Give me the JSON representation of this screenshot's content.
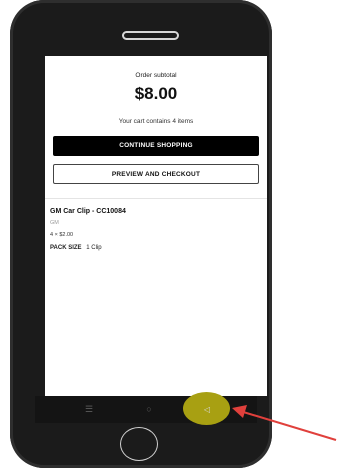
{
  "cart": {
    "subtotal_label": "Order subtotal",
    "subtotal_amount": "$8.00",
    "item_count_text": "Your cart contains 4 items",
    "continue_label": "CONTINUE SHOPPING",
    "checkout_label": "PREVIEW AND CHECKOUT"
  },
  "item": {
    "title": "GM Car Clip - CC10084",
    "brand": "GM",
    "price_line": "4 × $2.00",
    "pack_size_label": "PACK SIZE",
    "pack_size_value": "1 Clip"
  },
  "nav": {
    "menu_icon": "☰",
    "home_icon": "○",
    "back_icon": "◁"
  },
  "colors": {
    "primary_button": "#000000",
    "back_highlight": "#a8a012",
    "annotation_arrow": "#e0403c"
  },
  "icons": [
    "recent-apps-icon",
    "home-circle-icon",
    "back-triangle-icon",
    "annotation-arrow-icon"
  ]
}
